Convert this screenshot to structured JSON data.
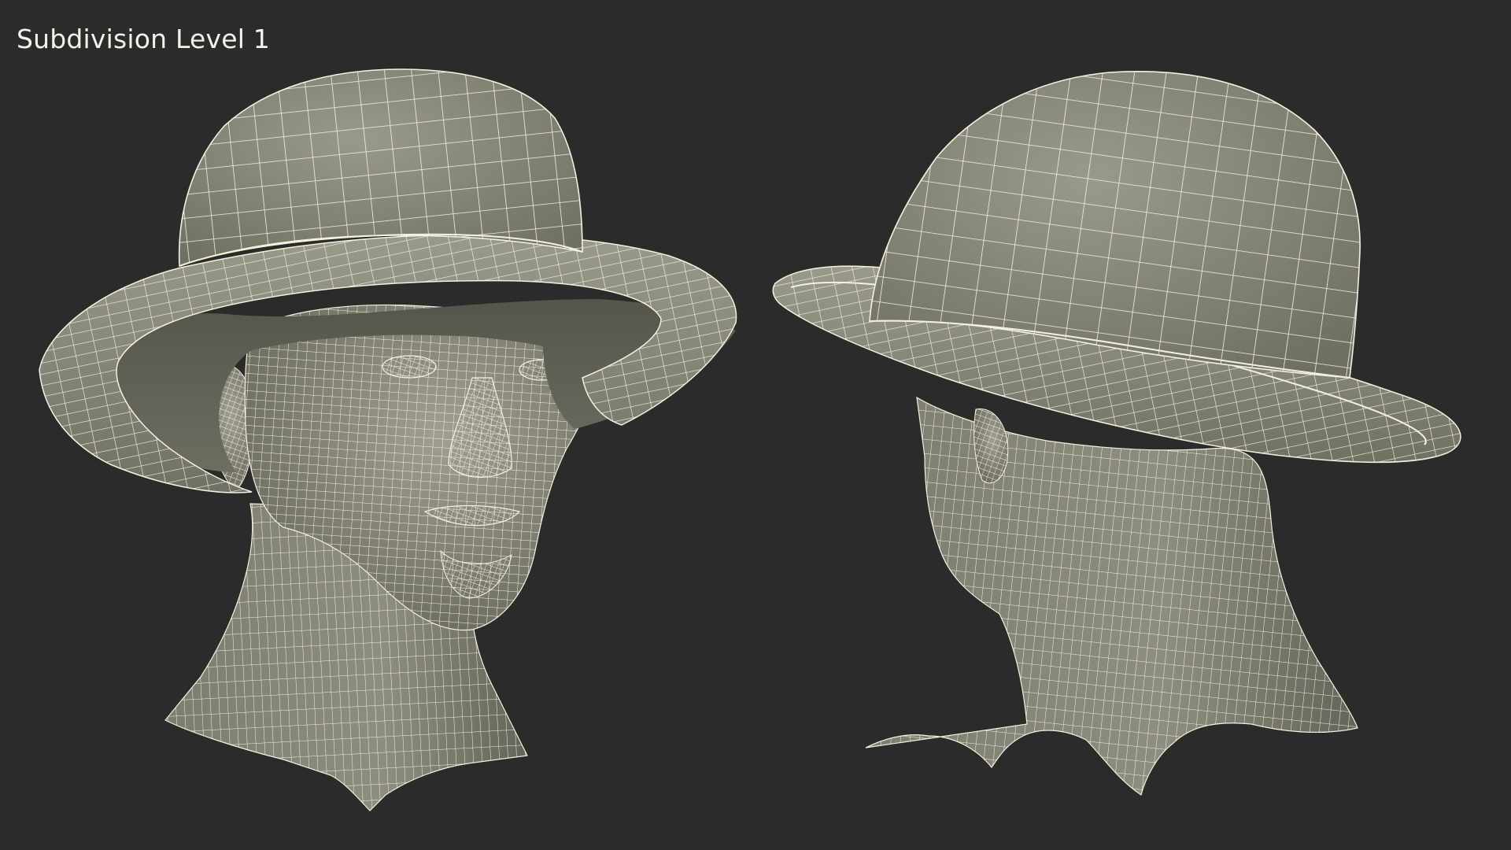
{
  "caption": "Subdivision Level 1",
  "colors": {
    "background": "#2b2b29",
    "mesh_fill": "#8a8a7c",
    "mesh_fill_dark": "#5f5f55",
    "wire": "#f4f1e0",
    "caption": "#f2f2ee"
  },
  "views": [
    {
      "name": "front-three-quarter-view",
      "subject": "head-with-bowler-hat"
    },
    {
      "name": "back-three-quarter-view",
      "subject": "head-with-bowler-hat"
    }
  ]
}
